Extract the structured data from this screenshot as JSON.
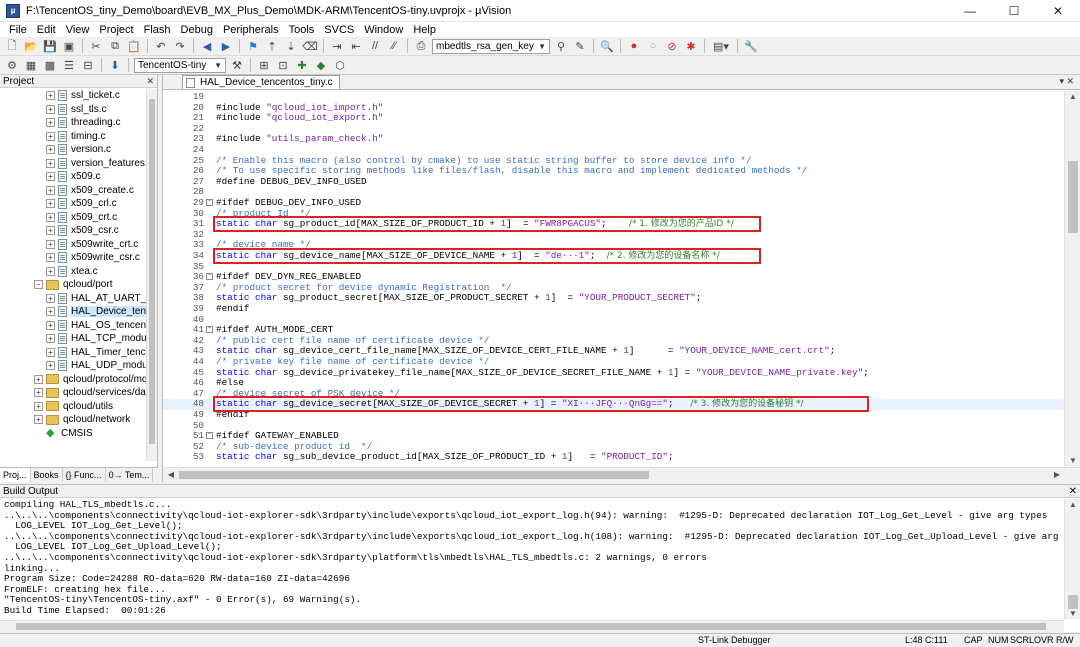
{
  "window": {
    "title": "F:\\TencentOS_tiny_Demo\\board\\EVB_MX_Plus_Demo\\MDK-ARM\\TencentOS-tiny.uvprojx - µVision",
    "minimize": "—",
    "maximize": "☐",
    "close": "✕"
  },
  "menu": [
    "File",
    "Edit",
    "View",
    "Project",
    "Flash",
    "Debug",
    "Peripherals",
    "Tools",
    "SVCS",
    "Window",
    "Help"
  ],
  "toolbar": {
    "config_combo": "mbedtls_rsa_gen_key",
    "target_combo": "TencentOS-tiny"
  },
  "project": {
    "title": "Project",
    "close": "✕",
    "tree": [
      {
        "label": "ssl_ticket.c",
        "kind": "file",
        "indent": 3
      },
      {
        "label": "ssl_tls.c",
        "kind": "file",
        "indent": 3
      },
      {
        "label": "threading.c",
        "kind": "file",
        "indent": 3
      },
      {
        "label": "timing.c",
        "kind": "file",
        "indent": 3
      },
      {
        "label": "version.c",
        "kind": "file",
        "indent": 3
      },
      {
        "label": "version_features.c",
        "kind": "file",
        "indent": 3
      },
      {
        "label": "x509.c",
        "kind": "file",
        "indent": 3
      },
      {
        "label": "x509_create.c",
        "kind": "file",
        "indent": 3
      },
      {
        "label": "x509_crl.c",
        "kind": "file",
        "indent": 3
      },
      {
        "label": "x509_crt.c",
        "kind": "file",
        "indent": 3
      },
      {
        "label": "x509_csr.c",
        "kind": "file",
        "indent": 3
      },
      {
        "label": "x509write_crt.c",
        "kind": "file",
        "indent": 3
      },
      {
        "label": "x509write_csr.c",
        "kind": "file",
        "indent": 3
      },
      {
        "label": "xtea.c",
        "kind": "file",
        "indent": 3
      },
      {
        "label": "qcloud/port",
        "kind": "folder-open",
        "indent": 2
      },
      {
        "label": "HAL_AT_UART_tence",
        "kind": "file",
        "indent": 3
      },
      {
        "label": "HAL_Device_tencent",
        "kind": "file",
        "indent": 3,
        "selected": true
      },
      {
        "label": "HAL_OS_tencentos_t",
        "kind": "file",
        "indent": 3
      },
      {
        "label": "HAL_TCP_module.c",
        "kind": "file",
        "indent": 3
      },
      {
        "label": "HAL_Timer_tencento",
        "kind": "file",
        "indent": 3
      },
      {
        "label": "HAL_UDP_module.c",
        "kind": "file",
        "indent": 3
      },
      {
        "label": "qcloud/protocol/mqtt",
        "kind": "folder",
        "indent": 2
      },
      {
        "label": "qcloud/services/data_te",
        "kind": "folder",
        "indent": 2
      },
      {
        "label": "qcloud/utils",
        "kind": "folder",
        "indent": 2
      },
      {
        "label": "qcloud/network",
        "kind": "folder",
        "indent": 2
      },
      {
        "label": "CMSIS",
        "kind": "gem",
        "indent": 2
      }
    ],
    "tabs": [
      "Proj...",
      "Books",
      "{} Func...",
      "0→ Tem..."
    ]
  },
  "editor": {
    "tab_label": "HAL_Device_tencentos_tiny.c",
    "tab_close": "▾ ✕",
    "lines": [
      {
        "n": "19",
        "parts": []
      },
      {
        "n": "20",
        "parts": [
          [
            "#include ",
            ""
          ],
          [
            "\"qcloud_iot_import.h\"",
            "str"
          ]
        ]
      },
      {
        "n": "21",
        "parts": [
          [
            "#include ",
            ""
          ],
          [
            "\"qcloud_iot_export.h\"",
            "str"
          ]
        ]
      },
      {
        "n": "22",
        "parts": []
      },
      {
        "n": "23",
        "parts": [
          [
            "#include ",
            ""
          ],
          [
            "\"utils_param_check.h\"",
            "str"
          ]
        ]
      },
      {
        "n": "24",
        "parts": []
      },
      {
        "n": "25",
        "parts": [
          [
            "/* Enable this macro (also control by cmake) to use static string buffer to store device info */",
            "cmt"
          ]
        ]
      },
      {
        "n": "26",
        "parts": [
          [
            "/* To use specific storing methods like files/flash, disable this macro and implement dedicated methods */",
            "cmt"
          ]
        ]
      },
      {
        "n": "27",
        "parts": [
          [
            "#define DEBUG_DEV_INFO_USED",
            ""
          ]
        ]
      },
      {
        "n": "28",
        "parts": []
      },
      {
        "n": "29",
        "fold": "-",
        "parts": [
          [
            "#ifdef DEBUG_DEV_INFO_USED",
            ""
          ]
        ]
      },
      {
        "n": "30",
        "parts": [
          [
            "/* product Id  */",
            "cmt"
          ]
        ]
      },
      {
        "n": "31",
        "parts": [
          [
            "static char ",
            "kw"
          ],
          [
            "sg_product_id[MAX_SIZE_OF_PRODUCT_ID + ",
            ""
          ],
          [
            "1",
            "num"
          ],
          [
            "]  = ",
            ""
          ],
          [
            "\"FWR8PGACUS\"",
            "str"
          ],
          [
            ";    ",
            ""
          ],
          [
            "/* 1. 修改为您的产品ID */",
            "zh"
          ]
        ]
      },
      {
        "n": "32",
        "parts": []
      },
      {
        "n": "33",
        "parts": [
          [
            "/* device name */",
            "cmt"
          ]
        ]
      },
      {
        "n": "34",
        "parts": [
          [
            "static char ",
            "kw"
          ],
          [
            "sg_device_name[MAX_SIZE_OF_DEVICE_NAME + ",
            ""
          ],
          [
            "1",
            "num"
          ],
          [
            "]  = ",
            ""
          ],
          [
            "\"de···1\"",
            "str"
          ],
          [
            ";  ",
            ""
          ],
          [
            "/* 2. 修改为您的设备名称 */",
            "zh"
          ]
        ]
      },
      {
        "n": "35",
        "parts": []
      },
      {
        "n": "36",
        "fold": "-",
        "parts": [
          [
            "#ifdef DEV_DYN_REG_ENABLED",
            ""
          ]
        ]
      },
      {
        "n": "37",
        "parts": [
          [
            "/* product secret for device dynamic Registration  */",
            "cmt"
          ]
        ]
      },
      {
        "n": "38",
        "parts": [
          [
            "static char ",
            "kw"
          ],
          [
            "sg_product_secret[MAX_SIZE_OF_PRODUCT_SECRET + ",
            ""
          ],
          [
            "1",
            "num"
          ],
          [
            "]  = ",
            ""
          ],
          [
            "\"YOUR_PRODUCT_SECRET\"",
            "str"
          ],
          [
            ";",
            ""
          ]
        ]
      },
      {
        "n": "39",
        "parts": [
          [
            "#endif",
            ""
          ]
        ]
      },
      {
        "n": "40",
        "parts": []
      },
      {
        "n": "41",
        "fold": "-",
        "parts": [
          [
            "#ifdef AUTH_MODE_CERT",
            ""
          ]
        ]
      },
      {
        "n": "42",
        "parts": [
          [
            "/* public cert file name of certificate device */",
            "cmt"
          ]
        ]
      },
      {
        "n": "43",
        "parts": [
          [
            "static char ",
            "kw"
          ],
          [
            "sg_device_cert_file_name[MAX_SIZE_OF_DEVICE_CERT_FILE_NAME + ",
            ""
          ],
          [
            "1",
            "num"
          ],
          [
            "]      = ",
            ""
          ],
          [
            "\"YOUR_DEVICE_NAME_cert.crt\"",
            "str"
          ],
          [
            ";",
            ""
          ]
        ]
      },
      {
        "n": "44",
        "parts": [
          [
            "/* private key file name of certificate device */",
            "cmt"
          ]
        ]
      },
      {
        "n": "45",
        "parts": [
          [
            "static char ",
            "kw"
          ],
          [
            "sg_device_privatekey_file_name[MAX_SIZE_OF_DEVICE_SECRET_FILE_NAME + ",
            ""
          ],
          [
            "1",
            "num"
          ],
          [
            "] = ",
            ""
          ],
          [
            "\"YOUR_DEVICE_NAME_private.key\"",
            "str"
          ],
          [
            ";",
            ""
          ]
        ]
      },
      {
        "n": "46",
        "parts": [
          [
            "#else",
            ""
          ]
        ]
      },
      {
        "n": "47",
        "parts": [
          [
            "/* device secret of PSK device */",
            "cmt"
          ]
        ]
      },
      {
        "n": "48",
        "current": true,
        "parts": [
          [
            "static char ",
            "kw"
          ],
          [
            "sg_device_secret[MAX_SIZE_OF_DEVICE_SECRET + ",
            ""
          ],
          [
            "1",
            "num"
          ],
          [
            "] = ",
            ""
          ],
          [
            "\"XI···JFQ···QnGg==\"",
            "str"
          ],
          [
            ";   ",
            ""
          ],
          [
            "/* 3. 修改为您的设备秘钥 */",
            "zh"
          ]
        ]
      },
      {
        "n": "49",
        "parts": [
          [
            "#endif",
            ""
          ]
        ]
      },
      {
        "n": "50",
        "parts": []
      },
      {
        "n": "51",
        "fold": "-",
        "parts": [
          [
            "#ifdef GATEWAY_ENABLED",
            ""
          ]
        ]
      },
      {
        "n": "52",
        "parts": [
          [
            "/* sub-device product id  */",
            "cmt"
          ]
        ]
      },
      {
        "n": "53",
        "parts": [
          [
            "static char ",
            "kw"
          ],
          [
            "sg_sub_device_product_id[MAX_SIZE_OF_PRODUCT_ID + ",
            ""
          ],
          [
            "1",
            "num"
          ],
          [
            "]   = ",
            ""
          ],
          [
            "\"PRODUCT_ID\"",
            "str"
          ],
          [
            ";",
            ""
          ]
        ]
      }
    ]
  },
  "build": {
    "title": "Build Output",
    "close": "✕",
    "lines": [
      "compiling HAL_TLS_mbedtls.c...",
      "..\\..\\..\\components\\connectivity\\qcloud-iot-explorer-sdk\\3rdparty\\include\\exports\\qcloud_iot_export_log.h(94): warning:  #1295-D: Deprecated declaration IOT_Log_Get_Level - give arg types",
      "  LOG_LEVEL IOT_Log_Get_Level();",
      "..\\..\\..\\components\\connectivity\\qcloud-iot-explorer-sdk\\3rdparty\\include\\exports\\qcloud_iot_export_log.h(108): warning:  #1295-D: Deprecated declaration IOT_Log_Get_Upload_Level - give arg types",
      "  LOG_LEVEL IOT_Log_Get_Upload_Level();",
      "..\\..\\..\\components\\connectivity\\qcloud-iot-explorer-sdk\\3rdparty\\platform\\tls\\mbedtls\\HAL_TLS_mbedtls.c: 2 warnings, 0 errors",
      "linking...",
      "Program Size: Code=24288 RO-data=620 RW-data=160 ZI-data=42696",
      "FromELF: creating hex file...",
      "\"TencentOS-tiny\\TencentOS-tiny.axf\" - 0 Error(s), 69 Warning(s).",
      "Build Time Elapsed:  00:01:26"
    ]
  },
  "status": {
    "debugger": "ST-Link Debugger",
    "position": "L:48 C:111",
    "cap": "CAP",
    "num": "NUM",
    "scrl": "SCRL",
    "ovr": "OVR",
    "rw": "R/W"
  },
  "colors": {
    "highlight_box": "#e32020",
    "comment": "#3a6fbf",
    "keyword": "#0000ff",
    "string": "#7a1fa2",
    "chinese_comment": "#2e7d32"
  }
}
